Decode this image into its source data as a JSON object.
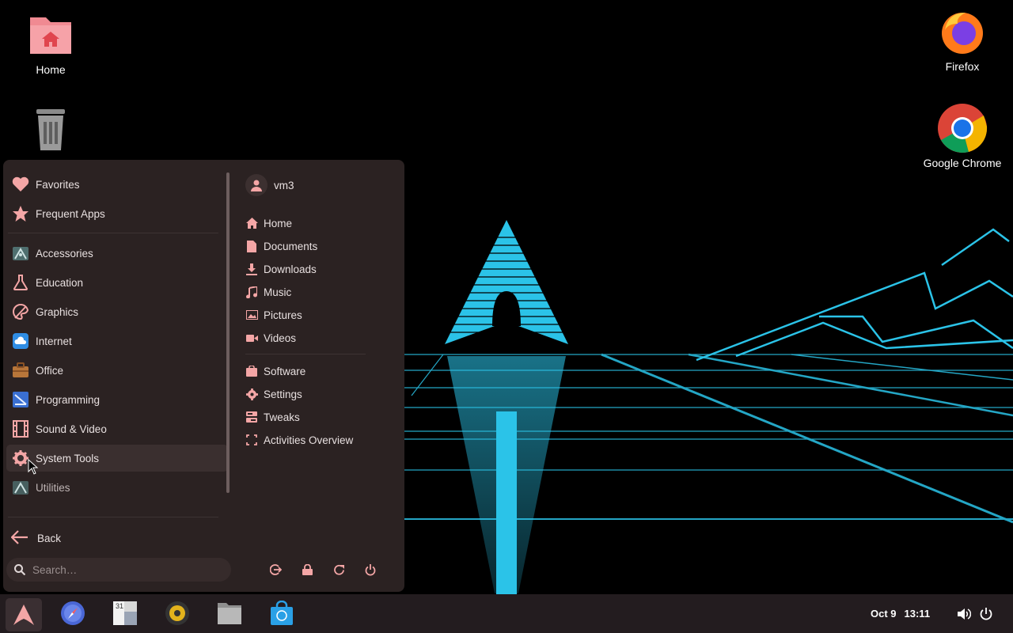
{
  "desktop": {
    "icons": [
      {
        "label": "Home",
        "icon": "home-folder-icon"
      },
      {
        "label": "Trash",
        "icon": "trash-icon"
      },
      {
        "label": "Firefox",
        "icon": "firefox-icon"
      },
      {
        "label": "Google Chrome",
        "icon": "chrome-icon"
      }
    ]
  },
  "menu": {
    "categories": [
      {
        "label": "Favorites",
        "icon": "heart-icon"
      },
      {
        "label": "Frequent Apps",
        "icon": "star-icon"
      },
      {
        "label": "Accessories",
        "icon": "accessories-icon"
      },
      {
        "label": "Education",
        "icon": "flask-icon"
      },
      {
        "label": "Graphics",
        "icon": "palette-icon"
      },
      {
        "label": "Internet",
        "icon": "cloud-icon"
      },
      {
        "label": "Office",
        "icon": "briefcase-icon"
      },
      {
        "label": "Programming",
        "icon": "programming-icon"
      },
      {
        "label": "Sound & Video",
        "icon": "film-icon"
      },
      {
        "label": "System Tools",
        "icon": "gear-icon"
      },
      {
        "label": "Utilities",
        "icon": "utilities-icon"
      }
    ],
    "user": {
      "name": "vm3"
    },
    "places": [
      {
        "label": "Home",
        "icon": "home-icon"
      },
      {
        "label": "Documents",
        "icon": "document-icon"
      },
      {
        "label": "Downloads",
        "icon": "download-icon"
      },
      {
        "label": "Music",
        "icon": "music-icon"
      },
      {
        "label": "Pictures",
        "icon": "picture-icon"
      },
      {
        "label": "Videos",
        "icon": "video-icon"
      }
    ],
    "system": [
      {
        "label": "Software",
        "icon": "software-bag-icon"
      },
      {
        "label": "Settings",
        "icon": "gear-icon"
      },
      {
        "label": "Tweaks",
        "icon": "tweaks-icon"
      },
      {
        "label": "Activities Overview",
        "icon": "activities-icon"
      }
    ],
    "back_label": "Back",
    "search_placeholder": "Search…",
    "session_buttons": [
      "logout-icon",
      "lock-icon",
      "restart-icon",
      "power-icon"
    ]
  },
  "taskbar": {
    "apps": [
      "arch-menu-icon",
      "web-browser-icon",
      "calendar-icon",
      "music-player-icon",
      "files-icon",
      "software-store-icon"
    ],
    "calendar_day": "31",
    "date": "Oct 9",
    "time": "13:11",
    "tray": [
      "volume-icon",
      "power-icon"
    ]
  },
  "colors": {
    "accent": "#f4a6a6",
    "menu_bg": "#2b2222",
    "neon": "#2bc3e8"
  }
}
